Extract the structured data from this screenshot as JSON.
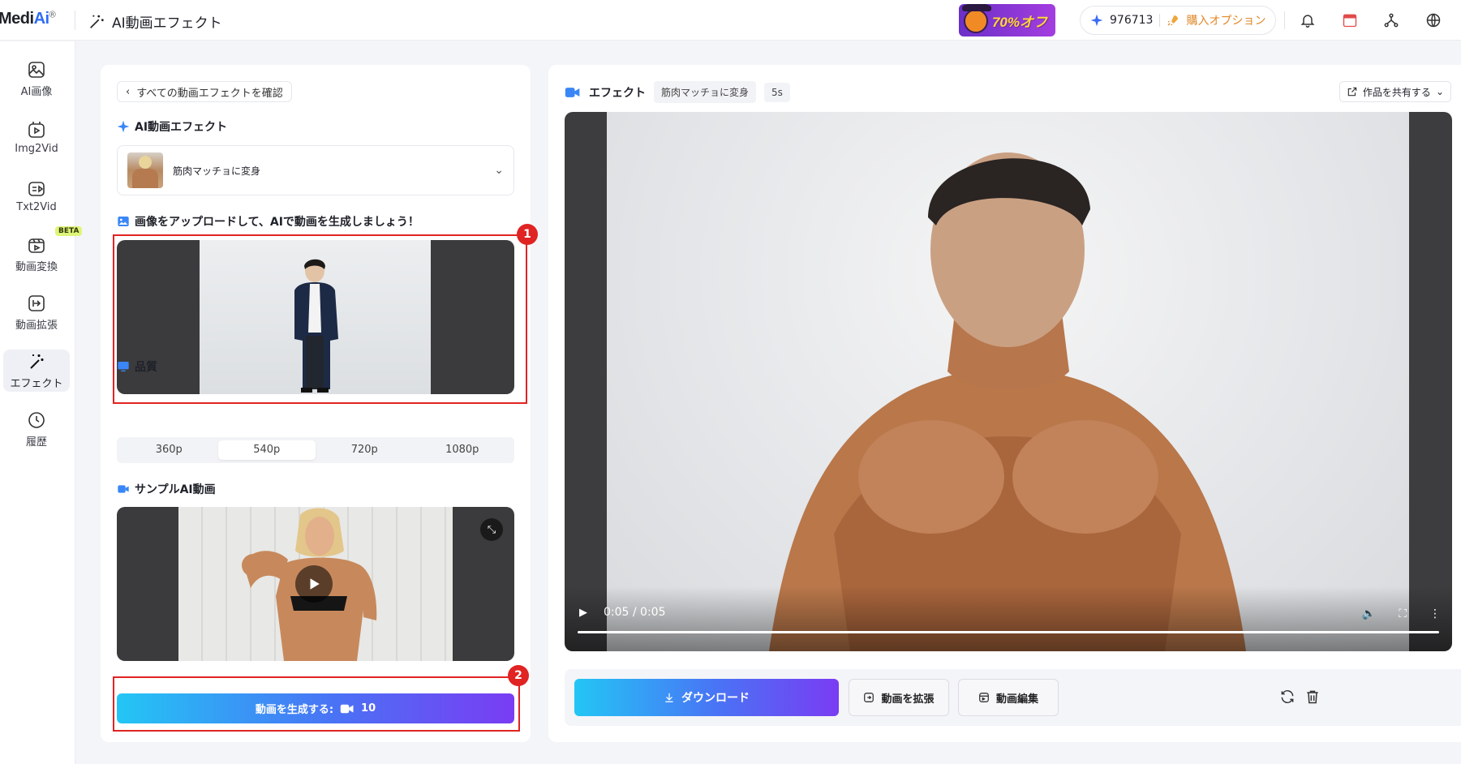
{
  "topbar": {
    "logo_main": "Medi",
    "logo_ai": "Ai",
    "logo_reg": "®",
    "app_title": "AI動画エフェクト",
    "promo_text": "70%オフ",
    "credits": "976713",
    "buy_option": "購入オプション"
  },
  "sidebar": {
    "items": [
      {
        "label": "AI画像"
      },
      {
        "label": "Img2Vid"
      },
      {
        "label": "Txt2Vid"
      },
      {
        "label": "動画変換"
      },
      {
        "label": "動画拡張"
      },
      {
        "label": "エフェクト"
      },
      {
        "label": "履歴"
      }
    ],
    "beta_label": "BETA"
  },
  "left_panel": {
    "back_label": "すべての動画エフェクトを確認",
    "effect_section_title": "AI動画エフェクト",
    "selected_effect": "筋肉マッチョに変身",
    "upload_title": "画像をアップロードして、AIで動画を生成しましょう！",
    "quality_title": "品質",
    "quality_options": [
      "360p",
      "540p",
      "720p",
      "1080p"
    ],
    "quality_selected": "540p",
    "sample_title": "サンプルAI動画",
    "generate_label": "動画を生成する:",
    "generate_cost": "10",
    "annotation_1": "1",
    "annotation_2": "2"
  },
  "right_panel": {
    "title": "エフェクト",
    "effect_tag": "筋肉マッチョに変身",
    "duration_tag": "5s",
    "share_label": "作品を共有する",
    "video_time": "0:05 / 0:05",
    "video_progress": 1.0,
    "download_label": "ダウンロード",
    "extend_label": "動画を拡張",
    "edit_label": "動画編集"
  },
  "colors": {
    "accent_gradient_start": "#23c6f5",
    "accent_gradient_end": "#7a3cf3",
    "annotation_red": "#e02323",
    "brand_blue": "#2d6cf6"
  }
}
